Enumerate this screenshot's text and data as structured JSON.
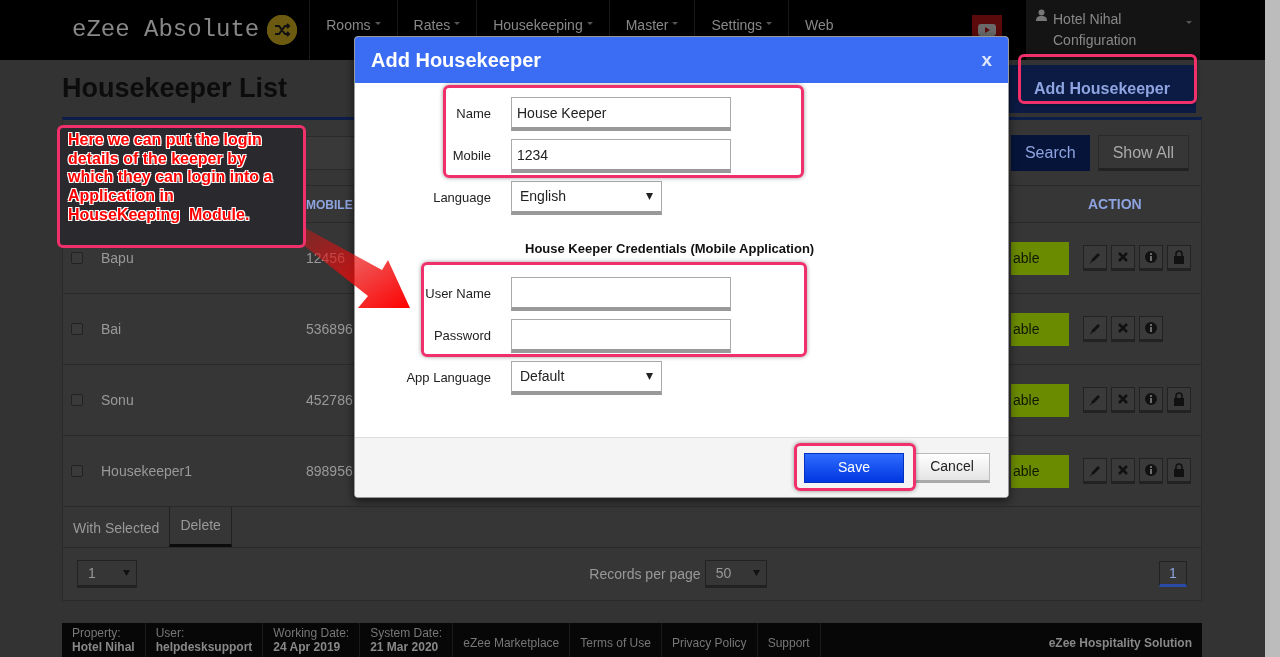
{
  "navbar": {
    "brand": "eZee Absolute",
    "menu": [
      {
        "label": "Rooms",
        "dropdown": true
      },
      {
        "label": "Rates",
        "dropdown": true
      },
      {
        "label": "Housekeeping",
        "dropdown": true
      },
      {
        "label": "Master",
        "dropdown": true
      },
      {
        "label": "Settings",
        "dropdown": true
      },
      {
        "label": "Web",
        "dropdown": false
      }
    ],
    "user": {
      "name": "Hotel Nihal",
      "role": "Configuration"
    }
  },
  "page": {
    "title": "Housekeeper List",
    "add_button": "Add Housekeeper"
  },
  "filter": {
    "buttons": [
      {
        "label": "Search",
        "kind": "primary"
      },
      {
        "label": "Show All",
        "kind": "secondary"
      }
    ]
  },
  "table": {
    "columns": [
      "MOBILE",
      "ACTION"
    ],
    "rows": [
      {
        "checked": false,
        "name": "Bapu",
        "mobile": "12456",
        "status": "able",
        "actions": [
          {
            "kind": "edit"
          },
          {
            "kind": "delete"
          },
          {
            "kind": "info"
          },
          {
            "kind": "lock"
          }
        ]
      },
      {
        "checked": false,
        "name": "Bai",
        "mobile": "536896",
        "status": "able",
        "actions": [
          {
            "kind": "edit"
          },
          {
            "kind": "delete"
          },
          {
            "kind": "info"
          }
        ]
      },
      {
        "checked": false,
        "name": "Sonu",
        "mobile": "452786",
        "status": "able",
        "actions": [
          {
            "kind": "edit"
          },
          {
            "kind": "delete"
          },
          {
            "kind": "info"
          },
          {
            "kind": "lock"
          }
        ]
      },
      {
        "checked": false,
        "name": "Housekeeper1",
        "mobile": "898956",
        "status": "able",
        "actions": [
          {
            "kind": "edit"
          },
          {
            "kind": "delete"
          },
          {
            "kind": "info"
          },
          {
            "kind": "lock"
          }
        ]
      }
    ]
  },
  "bulk": {
    "label": "With Selected",
    "button": "Delete"
  },
  "pagination": {
    "page_size_select": "1",
    "records_label": "Records per page",
    "records_value": "50",
    "pages": [
      {
        "label": "1",
        "selected": true
      }
    ]
  },
  "footer": {
    "info": [
      {
        "label": "Property:",
        "value": "Hotel Nihal"
      },
      {
        "label": "User:",
        "value": "helpdesksupport"
      },
      {
        "label": "Working Date:",
        "value": "24 Apr 2019"
      },
      {
        "label": "System Date:",
        "value": "21 Mar 2020"
      }
    ],
    "links": [
      "eZee Marketplace",
      "Terms of Use",
      "Privacy Policy",
      "Support"
    ],
    "brand": "eZee Hospitality Solution"
  },
  "modal": {
    "title": "Add Housekeeper",
    "close": "x",
    "fields": [
      {
        "kind": "text",
        "label": "Name",
        "value": "House Keeper"
      },
      {
        "kind": "text",
        "label": "Mobile",
        "value": "1234"
      },
      {
        "kind": "select",
        "label": "Language",
        "value": "English"
      },
      {
        "kind": "heading",
        "label": "House Keeper Credentials (Mobile Application)"
      },
      {
        "kind": "text",
        "label": "User Name"
      },
      {
        "kind": "password",
        "label": "Password"
      },
      {
        "kind": "select",
        "label": "App Language",
        "value": "Default"
      }
    ],
    "buttons": [
      {
        "label": "Save",
        "kind": "primary"
      },
      {
        "label": "Cancel",
        "kind": "secondary"
      }
    ]
  },
  "annotation": {
    "callout": "Here we can put the login\ndetails of the keeper by\nwhich they can login into a\nApplication in\nHouseKeeping  Module."
  }
}
